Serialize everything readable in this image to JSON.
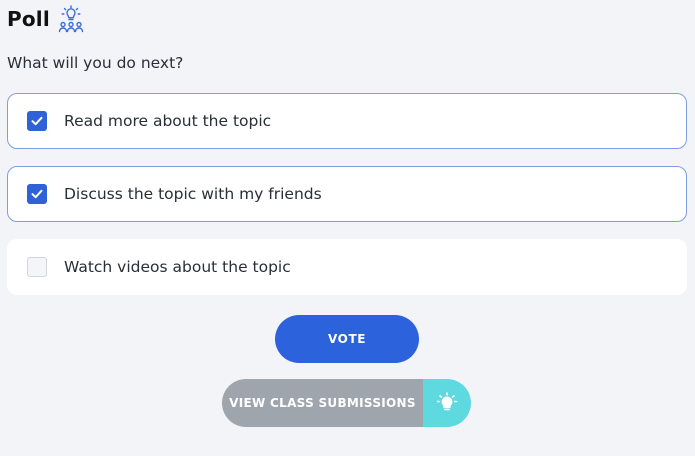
{
  "poll": {
    "title": "Poll",
    "icon": "idea-group-icon",
    "question": "What will you do next?",
    "options": [
      {
        "label": "Read more about the topic",
        "checked": true
      },
      {
        "label": "Discuss the topic with my friends",
        "checked": true
      },
      {
        "label": "Watch videos about the topic",
        "checked": false
      }
    ],
    "vote_label": "VOTE",
    "submissions_label": "VIEW CLASS SUBMISSIONS",
    "submissions_icon": "lightbulb-icon"
  },
  "colors": {
    "accent": "#2c62db",
    "checked_border": "#7f9ee0",
    "background": "#f3f4f8",
    "submissions_gray": "#9ea5ad",
    "submissions_cyan": "#5fd9e0"
  }
}
